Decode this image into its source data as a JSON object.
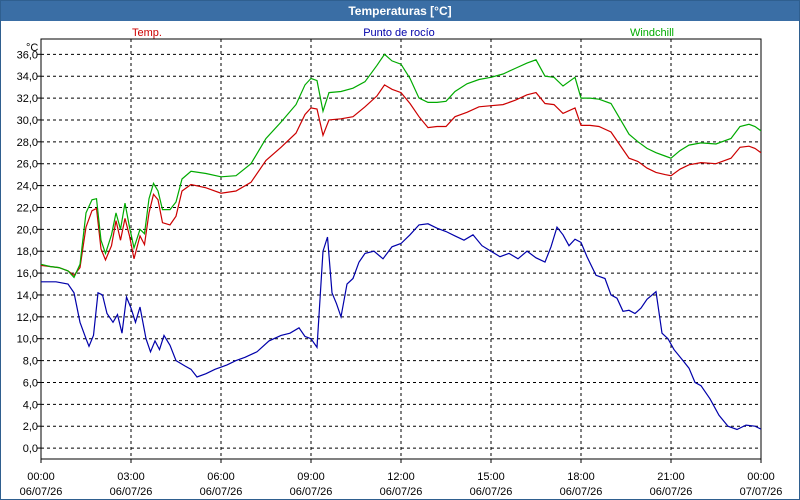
{
  "window": {
    "title": "Temperaturas [°C]"
  },
  "chart_data": {
    "type": "line",
    "title": "Temperaturas [°C]",
    "ylabel": "°C",
    "xlabel": "",
    "ylim": [
      -1,
      37.4
    ],
    "yticks": [
      "0,0",
      "2,0",
      "4,0",
      "6,0",
      "8,0",
      "10,0",
      "12,0",
      "14,0",
      "16,0",
      "18,0",
      "20,0",
      "22,0",
      "24,0",
      "26,0",
      "28,0",
      "30,0",
      "32,0",
      "34,0",
      "36,0"
    ],
    "xlim": [
      0,
      24
    ],
    "xticks": [
      {
        "time": "00:00",
        "date": "06/07/26"
      },
      {
        "time": "03:00",
        "date": "06/07/26"
      },
      {
        "time": "06:00",
        "date": "06/07/26"
      },
      {
        "time": "09:00",
        "date": "06/07/26"
      },
      {
        "time": "12:00",
        "date": "06/07/26"
      },
      {
        "time": "15:00",
        "date": "06/07/26"
      },
      {
        "time": "18:00",
        "date": "06/07/26"
      },
      {
        "time": "21:00",
        "date": "06/07/26"
      },
      {
        "time": "00:00",
        "date": "07/07/26"
      }
    ],
    "grid": true,
    "legend": "top",
    "series": [
      {
        "name": "Temp.",
        "color": "#cc0000",
        "points": [
          [
            0.0,
            16.7
          ],
          [
            0.3,
            16.6
          ],
          [
            0.6,
            16.5
          ],
          [
            0.9,
            16.2
          ],
          [
            1.1,
            15.8
          ],
          [
            1.3,
            16.5
          ],
          [
            1.5,
            20.2
          ],
          [
            1.7,
            21.7
          ],
          [
            1.85,
            21.9
          ],
          [
            2.0,
            18.2
          ],
          [
            2.15,
            17.2
          ],
          [
            2.35,
            18.5
          ],
          [
            2.5,
            20.8
          ],
          [
            2.65,
            19.0
          ],
          [
            2.8,
            21.0
          ],
          [
            2.95,
            19.4
          ],
          [
            3.1,
            17.3
          ],
          [
            3.3,
            19.4
          ],
          [
            3.45,
            18.6
          ],
          [
            3.6,
            21.5
          ],
          [
            3.75,
            23.2
          ],
          [
            3.9,
            22.7
          ],
          [
            4.05,
            20.6
          ],
          [
            4.3,
            20.4
          ],
          [
            4.5,
            21.2
          ],
          [
            4.7,
            23.5
          ],
          [
            5.0,
            24.1
          ],
          [
            5.5,
            23.8
          ],
          [
            6.0,
            23.3
          ],
          [
            6.5,
            23.5
          ],
          [
            7.0,
            24.3
          ],
          [
            7.5,
            26.3
          ],
          [
            8.0,
            27.5
          ],
          [
            8.5,
            28.8
          ],
          [
            8.8,
            30.5
          ],
          [
            9.0,
            31.1
          ],
          [
            9.2,
            31.0
          ],
          [
            9.4,
            28.6
          ],
          [
            9.6,
            30.0
          ],
          [
            10.0,
            30.1
          ],
          [
            10.4,
            30.3
          ],
          [
            10.8,
            31.2
          ],
          [
            11.2,
            32.2
          ],
          [
            11.45,
            33.2
          ],
          [
            11.7,
            32.8
          ],
          [
            12.0,
            32.5
          ],
          [
            12.3,
            31.5
          ],
          [
            12.6,
            30.3
          ],
          [
            12.9,
            29.3
          ],
          [
            13.2,
            29.4
          ],
          [
            13.5,
            29.4
          ],
          [
            13.8,
            30.3
          ],
          [
            14.2,
            30.7
          ],
          [
            14.6,
            31.2
          ],
          [
            15.0,
            31.3
          ],
          [
            15.4,
            31.4
          ],
          [
            15.8,
            31.8
          ],
          [
            16.2,
            32.3
          ],
          [
            16.5,
            32.5
          ],
          [
            16.8,
            31.5
          ],
          [
            17.1,
            31.4
          ],
          [
            17.4,
            30.6
          ],
          [
            17.8,
            31.1
          ],
          [
            18.0,
            29.5
          ],
          [
            18.3,
            29.5
          ],
          [
            18.6,
            29.4
          ],
          [
            19.0,
            28.9
          ],
          [
            19.3,
            27.7
          ],
          [
            19.6,
            26.5
          ],
          [
            19.9,
            26.2
          ],
          [
            20.2,
            25.6
          ],
          [
            20.5,
            25.2
          ],
          [
            20.8,
            25.0
          ],
          [
            21.0,
            24.9
          ],
          [
            21.3,
            25.5
          ],
          [
            21.6,
            25.9
          ],
          [
            22.0,
            26.1
          ],
          [
            22.5,
            26.0
          ],
          [
            23.0,
            26.5
          ],
          [
            23.3,
            27.5
          ],
          [
            23.6,
            27.6
          ],
          [
            23.8,
            27.4
          ],
          [
            24.0,
            27.0
          ]
        ]
      },
      {
        "name": "Punto de rocío",
        "color": "#0000aa",
        "points": [
          [
            0.0,
            15.2
          ],
          [
            0.5,
            15.2
          ],
          [
            0.9,
            15.0
          ],
          [
            1.1,
            14.2
          ],
          [
            1.3,
            11.5
          ],
          [
            1.5,
            10.0
          ],
          [
            1.6,
            9.3
          ],
          [
            1.75,
            10.3
          ],
          [
            1.9,
            14.2
          ],
          [
            2.05,
            14.0
          ],
          [
            2.2,
            12.3
          ],
          [
            2.4,
            11.5
          ],
          [
            2.55,
            12.2
          ],
          [
            2.7,
            10.5
          ],
          [
            2.85,
            13.8
          ],
          [
            3.0,
            12.8
          ],
          [
            3.15,
            11.5
          ],
          [
            3.3,
            12.9
          ],
          [
            3.5,
            10.0
          ],
          [
            3.65,
            8.8
          ],
          [
            3.8,
            9.8
          ],
          [
            3.95,
            9.0
          ],
          [
            4.1,
            10.3
          ],
          [
            4.3,
            9.4
          ],
          [
            4.5,
            8.0
          ],
          [
            4.8,
            7.5
          ],
          [
            5.0,
            7.2
          ],
          [
            5.2,
            6.5
          ],
          [
            5.5,
            6.8
          ],
          [
            5.8,
            7.2
          ],
          [
            6.2,
            7.6
          ],
          [
            6.5,
            8.0
          ],
          [
            6.8,
            8.3
          ],
          [
            7.2,
            8.8
          ],
          [
            7.6,
            9.8
          ],
          [
            8.0,
            10.3
          ],
          [
            8.3,
            10.5
          ],
          [
            8.6,
            11.0
          ],
          [
            8.8,
            10.2
          ],
          [
            9.0,
            10.0
          ],
          [
            9.2,
            9.2
          ],
          [
            9.4,
            18.0
          ],
          [
            9.55,
            19.3
          ],
          [
            9.7,
            14.2
          ],
          [
            9.85,
            13.2
          ],
          [
            10.0,
            12.0
          ],
          [
            10.2,
            15.0
          ],
          [
            10.4,
            15.5
          ],
          [
            10.6,
            17.0
          ],
          [
            10.8,
            17.8
          ],
          [
            11.1,
            18.0
          ],
          [
            11.4,
            17.3
          ],
          [
            11.7,
            18.4
          ],
          [
            12.0,
            18.7
          ],
          [
            12.3,
            19.5
          ],
          [
            12.6,
            20.4
          ],
          [
            12.9,
            20.5
          ],
          [
            13.2,
            20.1
          ],
          [
            13.5,
            19.8
          ],
          [
            13.8,
            19.4
          ],
          [
            14.1,
            19.0
          ],
          [
            14.4,
            19.5
          ],
          [
            14.7,
            18.5
          ],
          [
            15.0,
            18.0
          ],
          [
            15.3,
            17.5
          ],
          [
            15.6,
            17.8
          ],
          [
            15.9,
            17.3
          ],
          [
            16.2,
            18.0
          ],
          [
            16.5,
            17.4
          ],
          [
            16.8,
            17.0
          ],
          [
            17.0,
            18.4
          ],
          [
            17.2,
            20.2
          ],
          [
            17.4,
            19.5
          ],
          [
            17.6,
            18.5
          ],
          [
            17.8,
            19.1
          ],
          [
            18.0,
            18.8
          ],
          [
            18.2,
            17.5
          ],
          [
            18.5,
            15.8
          ],
          [
            18.8,
            15.5
          ],
          [
            19.0,
            14.0
          ],
          [
            19.2,
            13.7
          ],
          [
            19.4,
            12.5
          ],
          [
            19.6,
            12.6
          ],
          [
            19.8,
            12.3
          ],
          [
            20.0,
            12.8
          ],
          [
            20.2,
            13.6
          ],
          [
            20.5,
            14.3
          ],
          [
            20.7,
            10.5
          ],
          [
            20.9,
            10.0
          ],
          [
            21.1,
            9.0
          ],
          [
            21.4,
            8.0
          ],
          [
            21.6,
            7.3
          ],
          [
            21.8,
            6.0
          ],
          [
            22.0,
            5.7
          ],
          [
            22.3,
            4.5
          ],
          [
            22.6,
            3.0
          ],
          [
            22.9,
            2.0
          ],
          [
            23.2,
            1.7
          ],
          [
            23.5,
            2.1
          ],
          [
            23.8,
            2.0
          ],
          [
            24.1,
            1.6
          ],
          [
            24.3,
            0.8
          ],
          [
            24.5,
            0.5
          ],
          [
            24.7,
            1.3
          ],
          [
            25.0,
            1.6
          ],
          [
            25.3,
            2.0
          ]
        ]
      },
      {
        "name": "Windchill",
        "color": "#00aa00",
        "points": [
          [
            0.0,
            16.8
          ],
          [
            0.3,
            16.6
          ],
          [
            0.6,
            16.5
          ],
          [
            0.9,
            16.2
          ],
          [
            1.1,
            15.6
          ],
          [
            1.3,
            16.8
          ],
          [
            1.5,
            21.5
          ],
          [
            1.7,
            22.7
          ],
          [
            1.85,
            22.8
          ],
          [
            2.0,
            19.0
          ],
          [
            2.15,
            17.8
          ],
          [
            2.35,
            19.5
          ],
          [
            2.5,
            21.5
          ],
          [
            2.65,
            20.0
          ],
          [
            2.8,
            22.4
          ],
          [
            2.95,
            20.2
          ],
          [
            3.1,
            18.3
          ],
          [
            3.3,
            20.0
          ],
          [
            3.45,
            19.6
          ],
          [
            3.6,
            22.8
          ],
          [
            3.75,
            24.2
          ],
          [
            3.9,
            23.5
          ],
          [
            4.05,
            21.8
          ],
          [
            4.3,
            21.8
          ],
          [
            4.5,
            22.5
          ],
          [
            4.7,
            24.6
          ],
          [
            5.0,
            25.3
          ],
          [
            5.5,
            25.1
          ],
          [
            6.0,
            24.8
          ],
          [
            6.5,
            24.9
          ],
          [
            7.0,
            26.0
          ],
          [
            7.5,
            28.3
          ],
          [
            8.0,
            29.8
          ],
          [
            8.5,
            31.4
          ],
          [
            8.8,
            33.2
          ],
          [
            9.0,
            33.8
          ],
          [
            9.2,
            33.6
          ],
          [
            9.4,
            30.8
          ],
          [
            9.6,
            32.5
          ],
          [
            10.0,
            32.6
          ],
          [
            10.4,
            32.9
          ],
          [
            10.8,
            33.5
          ],
          [
            11.2,
            35.0
          ],
          [
            11.45,
            36.0
          ],
          [
            11.7,
            35.4
          ],
          [
            12.0,
            35.1
          ],
          [
            12.3,
            33.8
          ],
          [
            12.6,
            32.0
          ],
          [
            12.9,
            31.6
          ],
          [
            13.2,
            31.6
          ],
          [
            13.5,
            31.7
          ],
          [
            13.8,
            32.6
          ],
          [
            14.2,
            33.3
          ],
          [
            14.6,
            33.7
          ],
          [
            15.0,
            33.9
          ],
          [
            15.4,
            34.2
          ],
          [
            15.8,
            34.7
          ],
          [
            16.2,
            35.2
          ],
          [
            16.5,
            35.5
          ],
          [
            16.8,
            34.0
          ],
          [
            17.1,
            33.9
          ],
          [
            17.4,
            33.1
          ],
          [
            17.8,
            33.9
          ],
          [
            18.0,
            32.0
          ],
          [
            18.3,
            32.0
          ],
          [
            18.6,
            31.9
          ],
          [
            19.0,
            31.5
          ],
          [
            19.3,
            30.1
          ],
          [
            19.6,
            28.7
          ],
          [
            19.9,
            28.0
          ],
          [
            20.2,
            27.4
          ],
          [
            20.5,
            27.0
          ],
          [
            20.8,
            26.7
          ],
          [
            21.0,
            26.5
          ],
          [
            21.3,
            27.2
          ],
          [
            21.6,
            27.7
          ],
          [
            22.0,
            27.9
          ],
          [
            22.5,
            27.8
          ],
          [
            23.0,
            28.3
          ],
          [
            23.3,
            29.4
          ],
          [
            23.6,
            29.6
          ],
          [
            23.8,
            29.4
          ],
          [
            24.0,
            29.0
          ]
        ]
      }
    ]
  }
}
